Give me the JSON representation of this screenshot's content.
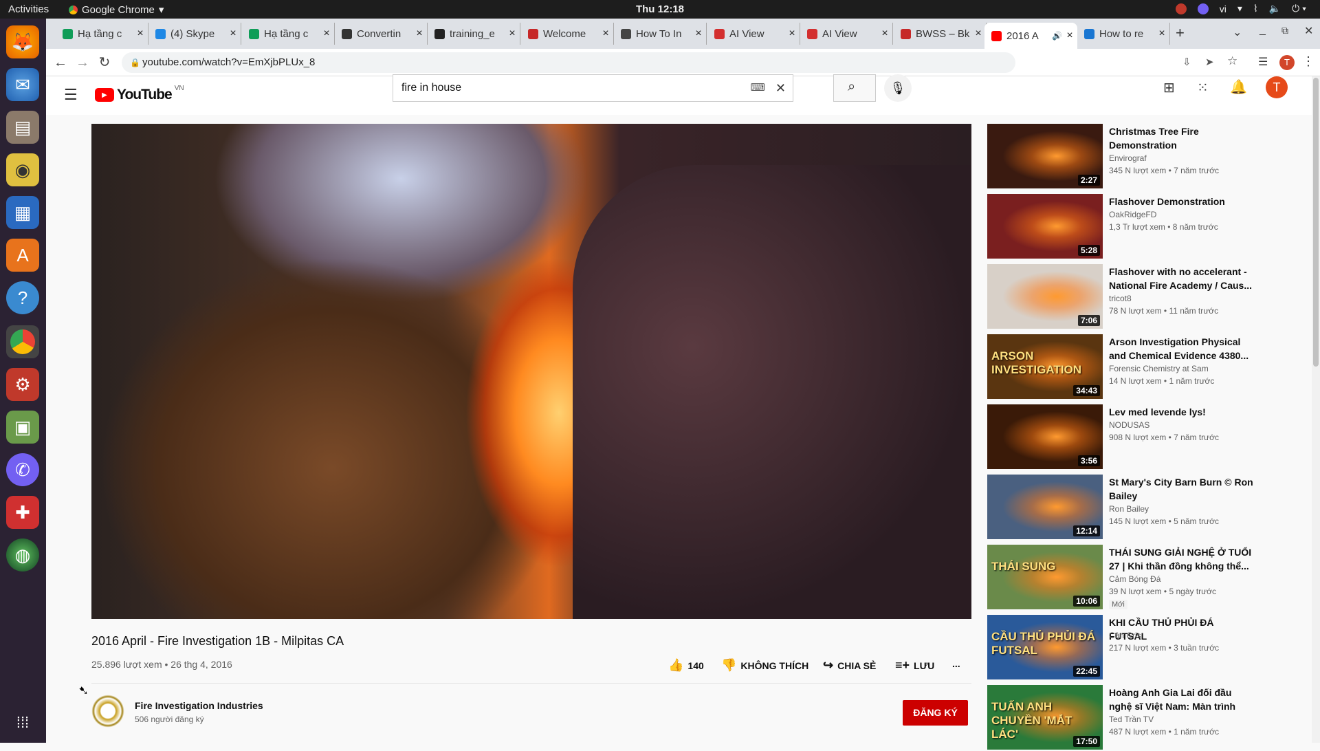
{
  "topbar": {
    "activities": "Activities",
    "app": "Google Chrome",
    "clock": "Thu 12:18",
    "lang": "vi"
  },
  "tabs": [
    {
      "title": "Hạ tầng c",
      "color": "#0f9d58"
    },
    {
      "title": "(4) Skype",
      "color": "#1e88e5"
    },
    {
      "title": "Hạ tầng c",
      "color": "#0f9d58"
    },
    {
      "title": "Convertin",
      "color": "#333333"
    },
    {
      "title": "training_e",
      "color": "#222222"
    },
    {
      "title": "Welcome",
      "color": "#c62828"
    },
    {
      "title": "How To In",
      "color": "#444444"
    },
    {
      "title": "AI View",
      "color": "#d32f2f"
    },
    {
      "title": "AI View",
      "color": "#d32f2f"
    },
    {
      "title": "BWSS – Bk",
      "color": "#c62828"
    },
    {
      "title": "2016 A",
      "color": "#ff0000"
    },
    {
      "title": "How to re",
      "color": "#1976d2"
    }
  ],
  "url": "youtube.com/watch?v=EmXjbPLUx_8",
  "yt": {
    "logo": "YouTube",
    "region": "VN",
    "search_value": "fire in house",
    "avatar": "T"
  },
  "video": {
    "title": "2016 April - Fire Investigation 1B - Milpitas CA",
    "stats": "25.896 lượt xem • 26 thg 4, 2016",
    "likes": "140",
    "dislike": "KHÔNG THÍCH",
    "share": "CHIA SẺ",
    "save": "LƯU",
    "more": "..."
  },
  "channel": {
    "name": "Fire Investigation Industries",
    "subs": "506 người đăng ký",
    "subscribe": "ĐĂNG KÝ"
  },
  "related": [
    {
      "title": "Christmas Tree Fire Demonstration",
      "channel": "Envirograf",
      "meta": "345 N lượt xem • 7 năm trước",
      "dur": "2:27",
      "bg": "#3a1a10"
    },
    {
      "title": "Flashover Demonstration",
      "channel": "OakRidgeFD",
      "meta": "1,3 Tr lượt xem • 8 năm trước",
      "dur": "5:28",
      "bg": "#7a1f1f"
    },
    {
      "title": "Flashover with no accelerant - National Fire Academy / Caus...",
      "channel": "tricot8",
      "meta": "78 N lượt xem • 11 năm trước",
      "dur": "7:06",
      "bg": "#d8d0c8"
    },
    {
      "title": "Arson Investigation Physical and Chemical Evidence 4380...",
      "channel": "Forensic Chemistry at Sam",
      "meta": "14 N lượt xem • 1 năm trước",
      "dur": "34:43",
      "bg": "#5a3510",
      "overlay": "ARSON INVESTIGATION"
    },
    {
      "title": "Lev med levende lys!",
      "channel": "NODUSAS",
      "meta": "908 N lượt xem • 7 năm trước",
      "dur": "3:56",
      "bg": "#3a1a08"
    },
    {
      "title": "St Mary's City Barn Burn © Ron Bailey",
      "channel": "Ron Bailey",
      "meta": "145 N lượt xem • 5 năm trước",
      "dur": "12:14",
      "bg": "#4a6080"
    },
    {
      "title": "THÁI SUNG GIẢI NGHỆ Ở TUỔI 27 | Khi thần đồng không thể...",
      "channel": "Cảm Bóng Đá",
      "meta": "39 N lượt xem • 5 ngày trước",
      "dur": "10:06",
      "bg": "#6a8a4a",
      "badge": "Mới",
      "overlay": "THÁI SUNG"
    },
    {
      "title": "KHI CẦU THỦ PHỦI ĐÁ FUTSAL",
      "channel": "Cân Cris",
      "meta": "217 N lượt xem • 3 tuần trước",
      "dur": "22:45",
      "bg": "#2a5a9a",
      "overlay": "CẦU THỦ PHỦI ĐÁ FUTSAL"
    },
    {
      "title": "Hoàng Anh Gia Lai đối đầu nghệ sĩ Việt Nam: Màn trình diễn ski...",
      "channel": "Ted Trần TV",
      "meta": "487 N lượt xem • 1 năm trước",
      "dur": "17:50",
      "bg": "#2a7a3a",
      "overlay": "TUẤN ANH CHUYỀN 'MẮT LÁC'"
    }
  ]
}
